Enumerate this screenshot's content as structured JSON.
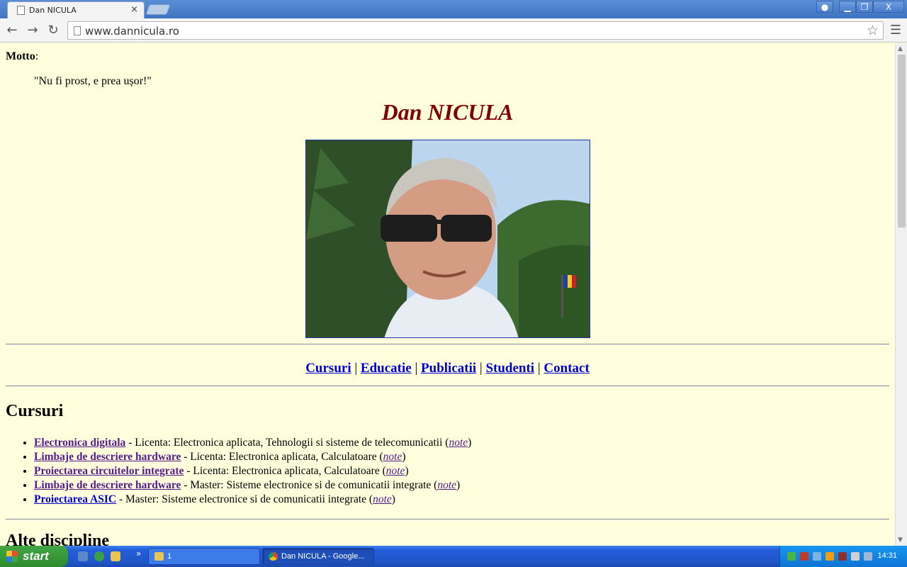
{
  "browser": {
    "tab_title": "Dan NICULA",
    "tab_close": "×",
    "url": "www.dannicula.ro",
    "window_buttons": {
      "minimize": "▁",
      "maximize": "❐",
      "close": "X"
    }
  },
  "page": {
    "motto_label": "Motto",
    "motto_colon": ":",
    "motto_text": "\"Nu fi prost, e prea ușor!\"",
    "name_heading": "Dan NICULA",
    "nav_links": [
      "Cursuri",
      "Educatie",
      "Publicatii",
      "Studenti",
      "Contact"
    ],
    "nav_separator": "|",
    "cursuri_heading": "Cursuri",
    "courses": [
      {
        "title": "Electronica digitala",
        "desc": " - Licenta: Electronica aplicata, Tehnologii si sisteme de telecomunicatii (",
        "note": "note",
        "close": ")"
      },
      {
        "title": "Limbaje de descriere hardware",
        "desc": " - Licenta: Electronica aplicata, Calculatoare (",
        "note": "note",
        "close": ")"
      },
      {
        "title": "Proiectarea circuitelor integrate",
        "desc": " - Licenta: Electronica aplicata, Calculatoare (",
        "note": "note",
        "close": ")"
      },
      {
        "title": "Limbaje de descriere hardware",
        "desc": " - Master: Sisteme electronice si de comunicatii integrate (",
        "note": "note",
        "close": ")"
      },
      {
        "title": "Proiectarea ASIC",
        "desc": " - Master: Sisteme electronice si de comunicatii integrate (",
        "note": "note",
        "close": ")"
      }
    ],
    "alte_heading": "Alte discipline"
  },
  "taskbar": {
    "start_label": "start",
    "chevron": "»",
    "task_folder": "1",
    "task_chrome": "Dan NICULA - Google...",
    "clock": "14:31"
  }
}
